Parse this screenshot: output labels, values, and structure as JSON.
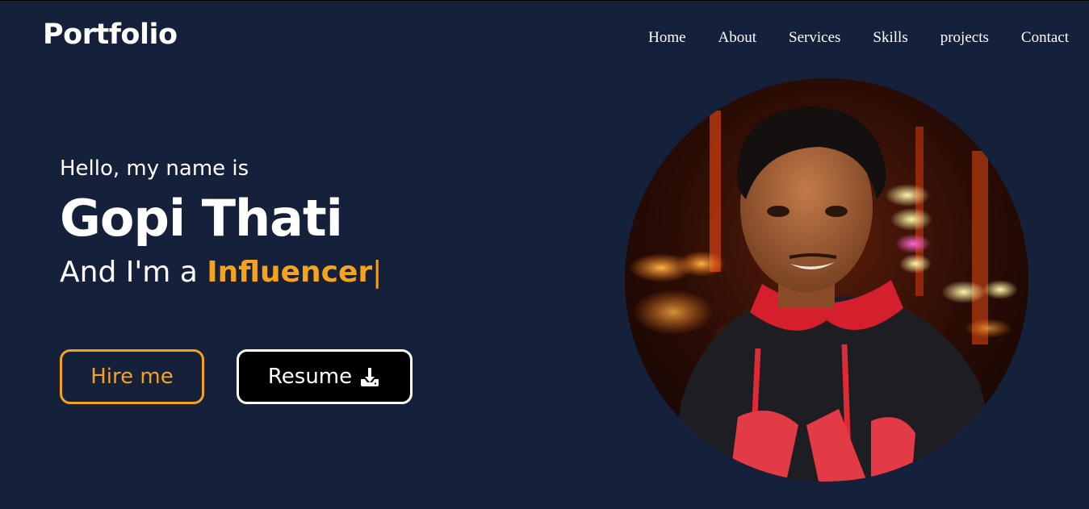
{
  "header": {
    "logo": "Portfolio",
    "nav": [
      "Home",
      "About",
      "Services",
      "Skills",
      "projects",
      "Contact"
    ]
  },
  "hero": {
    "greeting": "Hello, my name is",
    "name": "Gopi Thati",
    "tagline_prefix": "And I'm a ",
    "role": "Influencer",
    "cursor": "|",
    "hire_label": "Hire me",
    "resume_label": "Resume"
  },
  "colors": {
    "background": "#15203b",
    "accent": "#f5a21d",
    "text": "#ffffff"
  },
  "icons": {
    "resume": "download-icon"
  }
}
